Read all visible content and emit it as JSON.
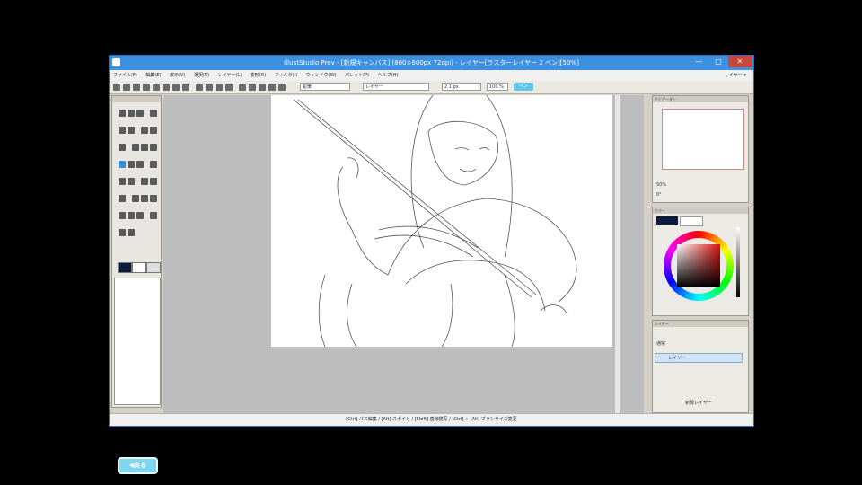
{
  "window": {
    "title": "IllustStudio Prev - [新規キャンバス] (800×600px 72dpi) - レイヤー[ラスターレイヤー 2 ペン][50%]",
    "minimize": "—",
    "maximize": "□",
    "close": "✕"
  },
  "menu": {
    "items": [
      "ファイル(F)",
      "編集(E)",
      "表示(V)",
      "選択(S)",
      "レイヤー(L)",
      "変形(R)",
      "フィルタ(I)",
      "ウィンドウ(W)",
      "パレット(P)",
      "ヘルプ(H)"
    ],
    "help_right": "レイヤー ▾"
  },
  "toolbar": {
    "brush_field": "鉛筆",
    "mode_field": "レイヤー",
    "size_field": "2.1 px",
    "zoom_field": "100 %",
    "badge": "ペン"
  },
  "right_panel": {
    "navigator_title": "ナビゲーター",
    "zoom_value": "50%",
    "rotate_value": "0°",
    "color_title": "カラー",
    "layer_title": "レイヤー",
    "blend_label": "通常",
    "layer_name": "レイヤー",
    "new_layer_button": "新規レイヤー"
  },
  "status_bar": "[Ctrl] パス編集 / [Alt] スポイト / [Shift] 直線描写 / [Ctrl] + [Alt] ブラシサイズ変更",
  "back_button": "◀戻る",
  "colors": {
    "titlebar": "#3d8fe0",
    "back_button": "#7fd6ee",
    "close_button": "#c9463d"
  }
}
